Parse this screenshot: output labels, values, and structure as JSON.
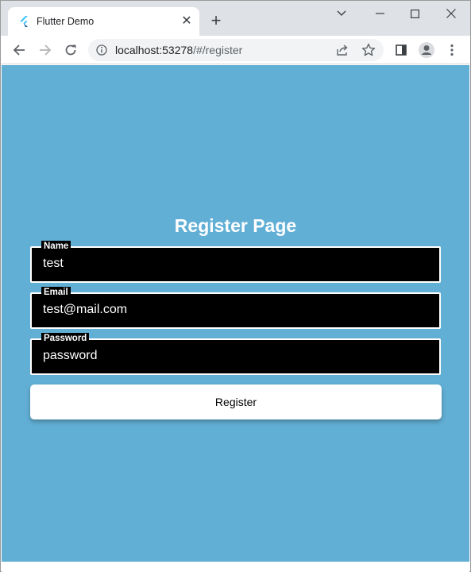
{
  "browser": {
    "tab_title": "Flutter Demo",
    "tab_close_glyph": "✕",
    "new_tab_glyph": "+",
    "url_host": "localhost:53278",
    "url_path": "/#/register",
    "icons": [
      "flutter-favicon",
      "back-arrow-icon",
      "forward-arrow-icon",
      "reload-icon",
      "info-icon",
      "share-icon",
      "star-icon",
      "side-panel-icon",
      "profile-icon",
      "kebab-menu-icon",
      "chevron-down-icon",
      "minimize-icon",
      "maximize-icon",
      "close-icon"
    ]
  },
  "page": {
    "background": "#62afd5",
    "title": "Register Page",
    "fields": [
      {
        "label": "Name",
        "value": "test"
      },
      {
        "label": "Email",
        "value": "test@mail.com"
      },
      {
        "label": "Password",
        "value": "password"
      }
    ],
    "register_label": "Register"
  }
}
